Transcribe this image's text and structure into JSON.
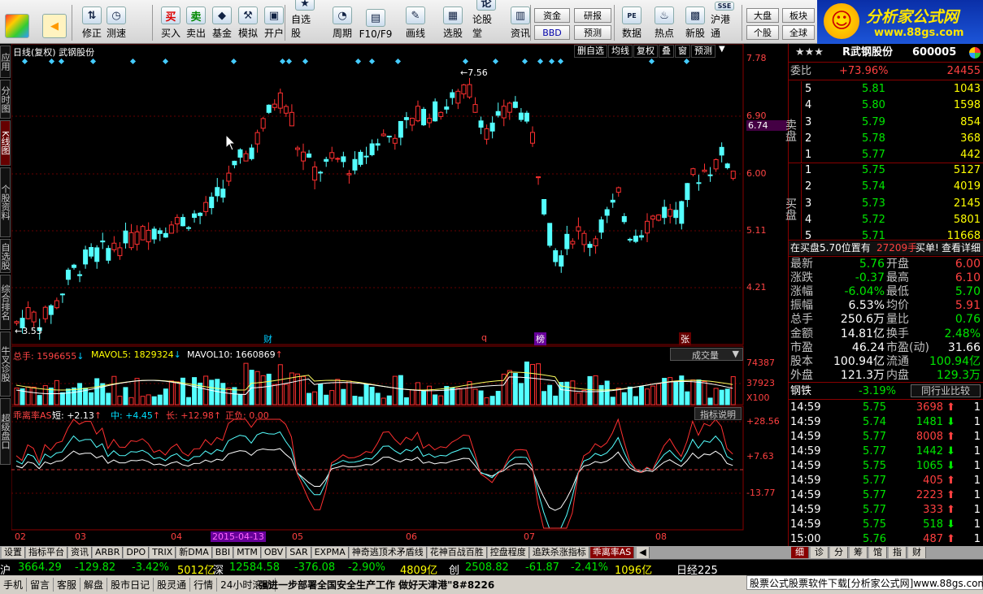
{
  "toolbar": {
    "buttons": [
      {
        "label": "修正",
        "icon": "up-down-icon",
        "sym": "⇅"
      },
      {
        "label": "测速",
        "icon": "clock-icon",
        "sym": "◷"
      },
      {
        "label": "买入",
        "icon": "buy-icon",
        "sym": "买"
      },
      {
        "label": "卖出",
        "icon": "sell-icon",
        "sym": "卖"
      },
      {
        "label": "基金",
        "icon": "fund-icon",
        "sym": "◆"
      },
      {
        "label": "模拟",
        "icon": "hammer-icon",
        "sym": "⚒"
      },
      {
        "label": "开户",
        "icon": "lock-icon",
        "sym": "▣"
      },
      {
        "label": "自选股",
        "icon": "star-icon",
        "sym": "★"
      },
      {
        "label": "周期",
        "icon": "cycle-icon",
        "sym": "◔"
      },
      {
        "label": "F10/F9",
        "icon": "f10-icon",
        "sym": "▤"
      },
      {
        "label": "画线",
        "icon": "pencil-icon",
        "sym": "✎"
      },
      {
        "label": "选股",
        "icon": "select-icon",
        "sym": "▦"
      },
      {
        "label": "论股堂",
        "icon": "forum-icon",
        "sym": "论"
      },
      {
        "label": "资讯",
        "icon": "news-icon",
        "sym": "▥"
      },
      {
        "label": "数据",
        "icon": "pe-icon",
        "sym": "PE"
      },
      {
        "label": "热点",
        "icon": "hot-icon",
        "sym": "♨"
      },
      {
        "label": "新股",
        "icon": "newstock-icon",
        "sym": "▩"
      },
      {
        "label": "沪港通",
        "icon": "hk-connect-icon",
        "sym": "SSE"
      }
    ],
    "small": {
      "zijin": "资金",
      "bbd": "BBD",
      "yanbao": "研报",
      "yuce": "预测",
      "dapan": "大盘",
      "gegu": "个股",
      "bankuai": "板块",
      "quanqiu": "全球"
    }
  },
  "logo": {
    "title": "分析家公式网",
    "url": "www.88gs.com"
  },
  "left_tabs": [
    "应用",
    "分时图",
    "K线图",
    "个股资料",
    "自选股",
    "综合排名",
    "牛叉诊股",
    "超级盘口"
  ],
  "chart": {
    "title": "日线(复权) 武钢股份",
    "menu": [
      "删自选",
      "均线",
      "复权",
      "叠",
      "窗",
      "预测"
    ],
    "price_axis": [
      "7.78",
      "6.90",
      "6.74",
      "6.00",
      "5.11",
      "4.21"
    ],
    "high_label": "7.56",
    "low_label": "3.53",
    "event_marks": [
      "财",
      "q",
      "榜",
      "张"
    ],
    "volume": {
      "label_total": "总手: 1596655",
      "label_ma5": "MAVOL5: 1829324",
      "label_ma10": "MAVOL10: 1660869",
      "dropdown": "成交量",
      "axis": [
        "74387",
        "37923",
        "X100"
      ]
    },
    "indicator": {
      "name": "乖离率AS",
      "short": "短: +2.13",
      "mid": "中: +4.45",
      "long": "长: +12.98",
      "pos": "正负: 0.00",
      "desc_btn": "指标说明",
      "axis": [
        "+28.56",
        "+7.63",
        "-13.77"
      ]
    },
    "x_axis": [
      "02",
      "03",
      "04",
      "2015-04-13",
      "05",
      "06",
      "07",
      "08"
    ]
  },
  "chart_data": {
    "type": "candlestick",
    "period": "daily",
    "ylim": [
      3.53,
      7.78
    ],
    "high": 7.56,
    "low": 3.53
  },
  "bottom_tabs": [
    "设置",
    "指标平台",
    "资讯",
    "ARBR",
    "DPO",
    "TRIX",
    "新DMA",
    "BBI",
    "MTM",
    "OBV",
    "SAR",
    "EXPMA",
    "神奇逃顶术矛盾线",
    "花神百战百胜",
    "控盘程度",
    "追跌杀涨指标",
    "乖离率AS"
  ],
  "bottom_right_tabs": [
    "细",
    "诊",
    "分",
    "筹",
    "馆",
    "指",
    "财"
  ],
  "index_bar": [
    {
      "t": "沪",
      "c": "wht"
    },
    {
      "t": "3664.29",
      "c": "grn"
    },
    {
      "t": "-129.82",
      "c": "grn"
    },
    {
      "t": "-3.42%",
      "c": "grn"
    },
    {
      "t": "5012亿",
      "c": "yel"
    },
    {
      "t": "深",
      "c": "wht"
    },
    {
      "t": "12584.58",
      "c": "grn"
    },
    {
      "t": "-376.08",
      "c": "grn"
    },
    {
      "t": "-2.90%",
      "c": "grn"
    },
    {
      "t": "4809亿",
      "c": "yel"
    },
    {
      "t": "创",
      "c": "wht"
    },
    {
      "t": "2508.82",
      "c": "grn"
    },
    {
      "t": "-61.87",
      "c": "grn"
    },
    {
      "t": "-2.41%",
      "c": "grn"
    },
    {
      "t": "1096亿",
      "c": "yel"
    },
    {
      "t": "日经225",
      "c": "wht"
    }
  ],
  "status_bar": {
    "items": [
      "手机",
      "留言",
      "客服",
      "解盘",
      "股市日记",
      "股灵通",
      "行情",
      "24小时滚动"
    ],
    "news": "强进一步部署全国安全生产工作 做好天津港\"8#8226",
    "watermark": "股票公式股票软件下载[分析家公式网]www.88gs.com"
  },
  "right": {
    "stars": "★★★",
    "name": "R武钢股份",
    "code": "600005",
    "weibi": {
      "label": "委比",
      "pct": "+73.96%",
      "val": "24455"
    },
    "sell": [
      {
        "n": "5",
        "p": "5.81",
        "v": "1043"
      },
      {
        "n": "4",
        "p": "5.80",
        "v": "1598"
      },
      {
        "n": "3",
        "p": "5.79",
        "v": "854"
      },
      {
        "n": "2",
        "p": "5.78",
        "v": "368"
      },
      {
        "n": "1",
        "p": "5.77",
        "v": "442"
      }
    ],
    "buy": [
      {
        "n": "1",
        "p": "5.75",
        "v": "5127"
      },
      {
        "n": "2",
        "p": "5.74",
        "v": "4019"
      },
      {
        "n": "3",
        "p": "5.73",
        "v": "2145"
      },
      {
        "n": "4",
        "p": "5.72",
        "v": "5801"
      },
      {
        "n": "5",
        "p": "5.71",
        "v": "11668"
      }
    ],
    "sell_label": "卖盘",
    "buy_label": "买盘",
    "notice": {
      "a": "在买盘5.70位置有",
      "b": "27209手",
      "c": "买单!",
      "d": "查看详细"
    },
    "quote": [
      [
        "最新",
        "5.76",
        "开盘",
        "6.00"
      ],
      [
        "涨跌",
        "-0.37",
        "最高",
        "6.10"
      ],
      [
        "涨幅",
        "-6.04%",
        "最低",
        "5.70"
      ],
      [
        "振幅",
        "6.53%",
        "均价",
        "5.91"
      ],
      [
        "总手",
        "250.6万",
        "量比",
        "0.76"
      ],
      [
        "金额",
        "14.81亿",
        "换手",
        "2.48%"
      ],
      [
        "市盈",
        "46.24",
        "市盈(动)",
        "31.66"
      ],
      [
        "股本",
        "100.94亿",
        "流通",
        "100.94亿"
      ],
      [
        "外盘",
        "121.3万",
        "内盘",
        "129.3万"
      ]
    ],
    "industry": {
      "name": "钢铁",
      "pct": "-3.19%",
      "btn": "同行业比较"
    },
    "ticks": [
      {
        "t": "14:59",
        "p": "5.75",
        "v": "3698",
        "d": "up",
        "n": "1"
      },
      {
        "t": "14:59",
        "p": "5.74",
        "v": "1481",
        "d": "down",
        "n": "1"
      },
      {
        "t": "14:59",
        "p": "5.77",
        "v": "8008",
        "d": "up",
        "n": "1"
      },
      {
        "t": "14:59",
        "p": "5.77",
        "v": "1442",
        "d": "down",
        "n": "1"
      },
      {
        "t": "14:59",
        "p": "5.75",
        "v": "1065",
        "d": "down",
        "n": "1"
      },
      {
        "t": "14:59",
        "p": "5.77",
        "v": "405",
        "d": "up",
        "n": "1"
      },
      {
        "t": "14:59",
        "p": "5.77",
        "v": "2223",
        "d": "up",
        "n": "1"
      },
      {
        "t": "14:59",
        "p": "5.77",
        "v": "333",
        "d": "up",
        "n": "1"
      },
      {
        "t": "14:59",
        "p": "5.75",
        "v": "518",
        "d": "down",
        "n": "1"
      },
      {
        "t": "15:00",
        "p": "5.76",
        "v": "487",
        "d": "up",
        "n": "1"
      }
    ]
  }
}
